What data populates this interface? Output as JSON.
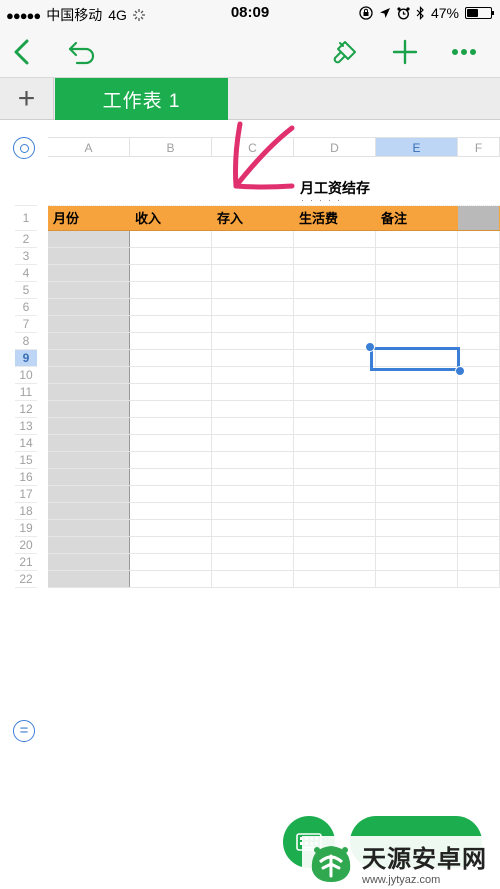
{
  "status_bar": {
    "signal_dots": "●●●●●",
    "carrier": "中国移动",
    "network": "4G",
    "time": "08:09",
    "battery_percent": "47%",
    "battery_level": 0.47
  },
  "toolbar": {
    "icons": [
      "back-icon",
      "undo-icon",
      "format-brush-icon",
      "add-icon",
      "more-icon"
    ]
  },
  "tabs": {
    "add_sheet_label": "+",
    "active_sheet": "工作表 1"
  },
  "sheet": {
    "columns": [
      "A",
      "B",
      "C",
      "D",
      "E",
      "F"
    ],
    "selected_column": "E",
    "selected_row": "9",
    "title": "月工资结存",
    "title_dots": "·····",
    "header_row": [
      "月份",
      "收入",
      "存入",
      "生活费",
      "备注",
      ""
    ],
    "rows": [
      "1",
      "2",
      "3",
      "4",
      "5",
      "6",
      "7",
      "8",
      "9",
      "10",
      "11",
      "12",
      "13",
      "14",
      "15",
      "16",
      "17",
      "18",
      "19",
      "20",
      "21",
      "22"
    ],
    "formula_button": "="
  },
  "watermark": {
    "name": "天源安卓网",
    "url": "www.jytyaz.com"
  },
  "colors": {
    "accent": "#1cae4e",
    "header_fill": "#f6a33e",
    "selection": "#3b7ed6",
    "annotation_arrow": "#e0306e"
  }
}
